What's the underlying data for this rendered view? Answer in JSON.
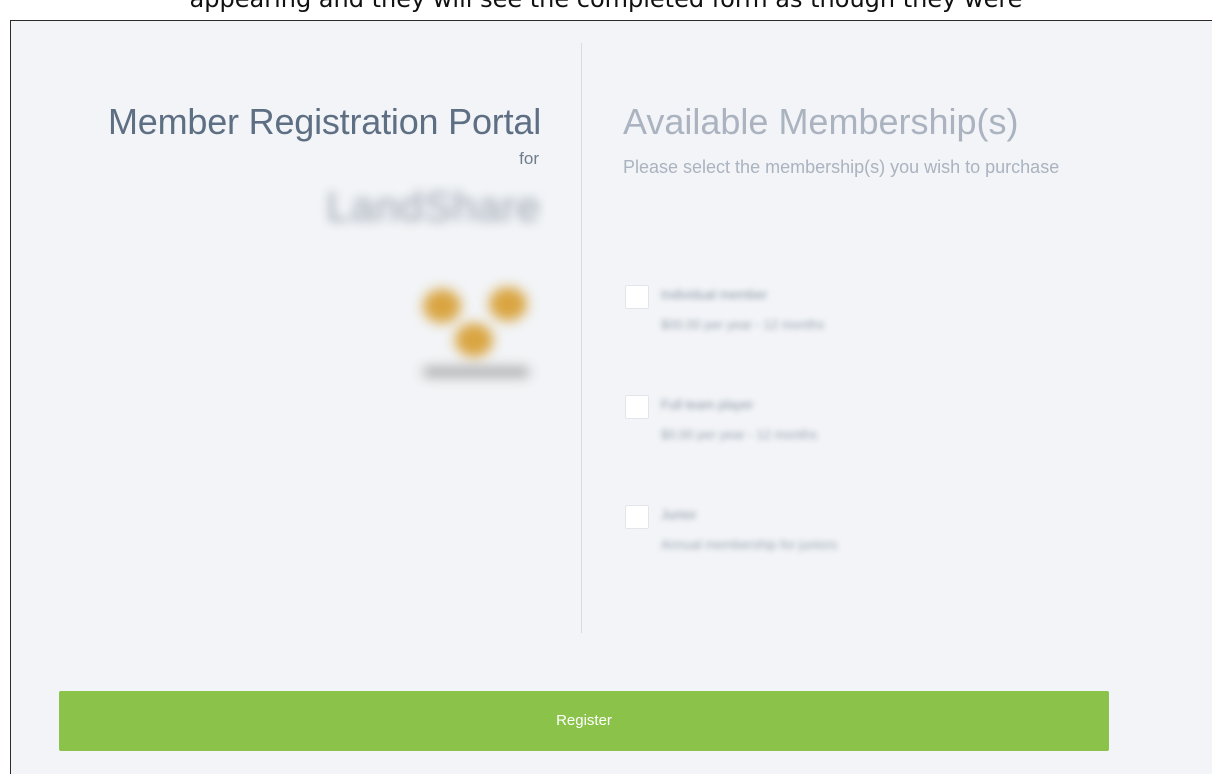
{
  "top_caption": "appearing and they will see the completed form as though they were",
  "left": {
    "title": "Member Registration Portal",
    "for_text": "for",
    "org_name": "LandShare"
  },
  "right": {
    "title": "Available Membership(s)",
    "subtitle": "Please select the membership(s) you wish to purchase"
  },
  "memberships": [
    {
      "name": "Individual member",
      "price": "$00.00 per year - 12 months"
    },
    {
      "name": "Full team player",
      "price": "$0.00 per year - 12 months"
    },
    {
      "name": "Junior",
      "price": "Annual membership for juniors"
    }
  ],
  "register_label": "Register",
  "colors": {
    "accent": "#8bc34a",
    "background": "#f2f4f7"
  }
}
